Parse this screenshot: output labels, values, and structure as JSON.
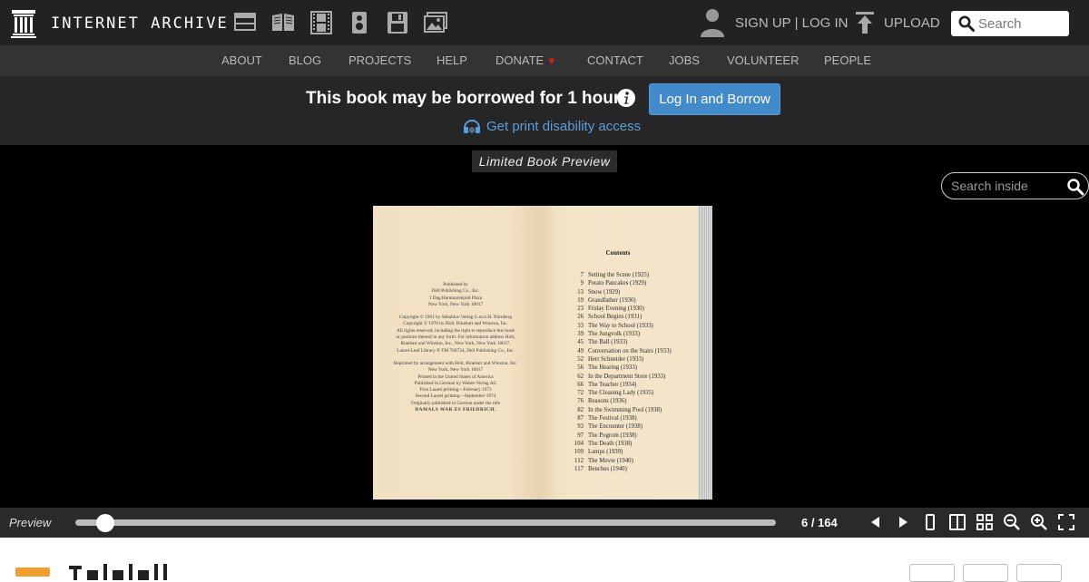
{
  "header": {
    "logo_text": "INTERNET ARCHIVE",
    "media_icons": [
      "web-icon",
      "texts-icon",
      "video-icon",
      "audio-icon",
      "software-icon",
      "images-icon"
    ],
    "auth_label": "SIGN UP | LOG IN",
    "upload_label": "UPLOAD",
    "search_placeholder": "Search"
  },
  "nav": {
    "items": [
      "ABOUT",
      "BLOG",
      "PROJECTS",
      "HELP",
      "DONATE",
      "CONTACT",
      "JOBS",
      "VOLUNTEER",
      "PEOPLE"
    ]
  },
  "borrow": {
    "message": "This book may be borrowed for 1 hour.",
    "button_label": "Log In and Borrow",
    "disability_link": "Get print disability access"
  },
  "viewer": {
    "preview_label": "Limited Book Preview",
    "search_inside_placeholder": "Search inside",
    "left_page": [
      "Published by",
      "Dell Publishing Co., Inc.",
      "1 Dag Hammarskjold Plaza",
      "New York, New York 10017",
      "",
      "Copyright © 1961 by Sebaldus-Verlag G.m.b.H. Nürnberg",
      "Copyright © 1970 by Holt, Rinehart and Winston, Inc.",
      "All rights reserved, including the right to reproduce this book",
      "or portions thereof in any form. For information address Holt,",
      "Rinehart and Winston, Inc., New York, New York 10017.",
      "Laurel-Leaf Library ® TM 766734, Dell Publishing Co., Inc.",
      "",
      "Reprinted by arrangement with Holt, Rinehart and Winston, Inc.",
      "New York, New York 10017",
      "Printed in the United States of America",
      "Published in German by Walter-Verlag AG",
      "First Laurel printing—February 1973",
      "Second Laurel printing—September 1974",
      "Originally published in German under the title",
      "DAMALS WAR ES FRIEDRICH."
    ],
    "contents_title": "Contents",
    "toc": [
      {
        "page": "7",
        "title": "Setting the Scene (1925)"
      },
      {
        "page": "9",
        "title": "Potato Pancakes (1929)"
      },
      {
        "page": "13",
        "title": "Snow (1929)"
      },
      {
        "page": "19",
        "title": "Grandfather (1930)"
      },
      {
        "page": "23",
        "title": "Friday Evening (1930)"
      },
      {
        "page": "26",
        "title": "School Begins (1931)"
      },
      {
        "page": "33",
        "title": "The Way to School (1933)"
      },
      {
        "page": "39",
        "title": "The Jungvolk (1933)"
      },
      {
        "page": "45",
        "title": "The Ball (1933)"
      },
      {
        "page": "49",
        "title": "Conversation on the Stairs (1933)"
      },
      {
        "page": "52",
        "title": "Herr Schneider (1933)"
      },
      {
        "page": "56",
        "title": "The Hearing (1933)"
      },
      {
        "page": "62",
        "title": "In the Department Store (1933)"
      },
      {
        "page": "66",
        "title": "The Teacher (1934)"
      },
      {
        "page": "72",
        "title": "The Cleaning Lady (1935)"
      },
      {
        "page": "76",
        "title": "Reasons (1936)"
      },
      {
        "page": "82",
        "title": "In the Swimming Pool (1938)"
      },
      {
        "page": "87",
        "title": "The Festival (1938)"
      },
      {
        "page": "93",
        "title": "The Encounter (1938)"
      },
      {
        "page": "97",
        "title": "The Pogrom (1938)"
      },
      {
        "page": "104",
        "title": "The Death (1938)"
      },
      {
        "page": "109",
        "title": "Lamps (1939)"
      },
      {
        "page": "112",
        "title": "The Movie (1940)"
      },
      {
        "page": "117",
        "title": "Benches (1940)"
      }
    ]
  },
  "controls": {
    "label": "Preview",
    "page_indicator": "6 / 164",
    "progress": 0.031
  },
  "colors": {
    "accent": "#428bca",
    "link": "#5a9fdc",
    "heart": "#e0171f"
  }
}
